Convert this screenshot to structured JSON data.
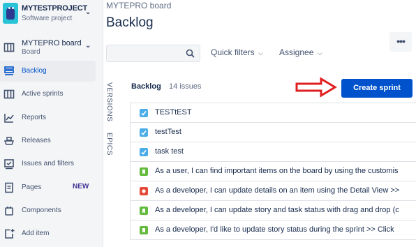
{
  "project": {
    "name": "MYTESTPROJECT",
    "type": "Software project",
    "avatar_icon": "robot-icon"
  },
  "board": {
    "name": "MYTEPRO board",
    "type": "Board"
  },
  "sidebar": {
    "items": [
      {
        "label": "Backlog",
        "icon": "backlog-icon",
        "active": true
      },
      {
        "label": "Active sprints",
        "icon": "columns-icon",
        "active": false
      },
      {
        "label": "Reports",
        "icon": "reports-icon",
        "active": false
      },
      {
        "label": "Releases",
        "icon": "ship-icon",
        "active": false
      },
      {
        "label": "Issues and filters",
        "icon": "issues-icon",
        "active": false
      },
      {
        "label": "Pages",
        "icon": "page-icon",
        "active": false,
        "badge": "NEW"
      },
      {
        "label": "Components",
        "icon": "component-icon",
        "active": false
      },
      {
        "label": "Add item",
        "icon": "add-item-icon",
        "active": false
      }
    ]
  },
  "header": {
    "breadcrumb": "MYTEPRO board",
    "title": "Backlog",
    "more_label": "•••"
  },
  "filters": {
    "search_placeholder": "",
    "quick_filters": "Quick filters",
    "assignee": "Assignee"
  },
  "side_tabs": {
    "versions": "VERSIONS",
    "epics": "EPICS"
  },
  "backlog": {
    "heading": "Backlog",
    "count": "14 issues",
    "create_sprint": "Create sprint",
    "issues": [
      {
        "type": "task",
        "summary": "TESTtEST"
      },
      {
        "type": "task",
        "summary": "testTest"
      },
      {
        "type": "task",
        "summary": "task test"
      },
      {
        "type": "story",
        "summary": "As a user, I can find important items on the board by using the customis"
      },
      {
        "type": "bug",
        "summary": "As a developer, I can update details on an item using the Detail View >>"
      },
      {
        "type": "story",
        "summary": "As a developer, I can update story and task status with drag and drop (c"
      },
      {
        "type": "story",
        "summary": "As a developer, I'd like to update story status during the sprint >> Click"
      }
    ]
  },
  "colors": {
    "primary": "#0052cc",
    "sidebar_bg": "#f4f5f7",
    "arrow_red": "#e02020",
    "story": "#63ba3c",
    "task": "#4bade8",
    "bug": "#e5493a"
  }
}
